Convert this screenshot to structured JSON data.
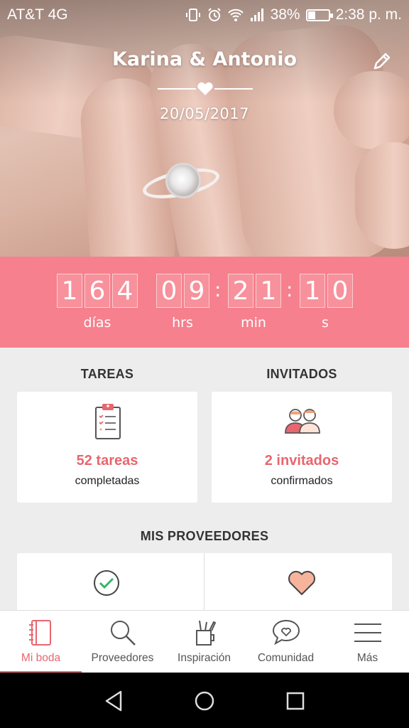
{
  "status_bar": {
    "carrier": "AT&T 4G",
    "battery": "38%",
    "time": "2:38 p. m.",
    "battery_level": 0.38
  },
  "header": {
    "couple_names": "Karina & Antonio",
    "wedding_date": "20/05/2017",
    "edit_icon": "pencil-icon"
  },
  "countdown": {
    "days": [
      "1",
      "6",
      "4"
    ],
    "hours": [
      "0",
      "9"
    ],
    "minutes": [
      "2",
      "1"
    ],
    "seconds": [
      "1",
      "0"
    ],
    "labels": {
      "days": "días",
      "hours": "hrs",
      "minutes": "min",
      "seconds": "s"
    }
  },
  "tasks": {
    "title": "TAREAS",
    "count_text": "52 tareas",
    "status_text": "completadas",
    "icon": "clipboard-checklist-icon"
  },
  "guests": {
    "title": "INVITADOS",
    "count_text": "2 invitados",
    "status_text": "confirmados",
    "icon": "couple-icon"
  },
  "vendors": {
    "title": "MIS PROVEEDORES",
    "icons": [
      "check-circle-icon",
      "heart-icon"
    ]
  },
  "bottom_nav": {
    "items": [
      {
        "label": "Mi boda",
        "icon": "notebook-icon",
        "active": true
      },
      {
        "label": "Proveedores",
        "icon": "search-icon",
        "active": false
      },
      {
        "label": "Inspiración",
        "icon": "pencil-cup-icon",
        "active": false
      },
      {
        "label": "Comunidad",
        "icon": "chat-heart-icon",
        "active": false
      },
      {
        "label": "Más",
        "icon": "menu-icon",
        "active": false
      }
    ]
  },
  "colors": {
    "accent": "#e8666f",
    "countdown_bg": "#f6808d",
    "page_bg": "#ededed"
  }
}
